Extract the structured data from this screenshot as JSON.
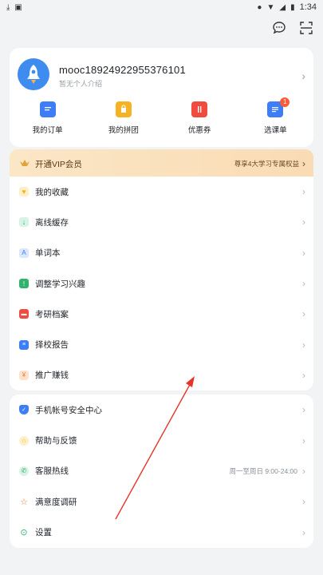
{
  "status_bar": {
    "time": "1:34"
  },
  "profile": {
    "username": "mooc18924922955376101",
    "intro": "暂无个人介绍"
  },
  "quick_actions": [
    {
      "label": "我的订单",
      "icon": "order-icon",
      "color": "#3d7df5"
    },
    {
      "label": "我的拼团",
      "icon": "group-buy-icon",
      "color": "#f5b323"
    },
    {
      "label": "优惠券",
      "icon": "coupon-icon",
      "color": "#f04b3e"
    },
    {
      "label": "选课单",
      "icon": "course-list-icon",
      "color": "#3d7df5",
      "badge": "1"
    }
  ],
  "vip": {
    "label": "开通VIP会员",
    "benefit": "尊享4大学习专属权益"
  },
  "menu_group_1": [
    {
      "label": "我的收藏",
      "icon": "favorite-icon",
      "color": "#f5b323"
    },
    {
      "label": "离线缓存",
      "icon": "download-icon",
      "color": "#2fb36d"
    },
    {
      "label": "单词本",
      "icon": "vocabulary-icon",
      "color": "#3d7df5"
    },
    {
      "label": "调整学习兴趣",
      "icon": "interest-icon",
      "color": "#2fb36d"
    },
    {
      "label": "考研档案",
      "icon": "folder-icon",
      "color": "#f04b3e"
    },
    {
      "label": "择校报告",
      "icon": "report-icon",
      "color": "#3d7df5"
    },
    {
      "label": "推广赚钱",
      "icon": "money-bag-icon",
      "color": "#f07b2e"
    }
  ],
  "menu_group_2": [
    {
      "label": "手机帐号安全中心",
      "icon": "shield-icon",
      "color": "#3d7df5"
    },
    {
      "label": "帮助与反馈",
      "icon": "headset-icon",
      "color": "#f5b323"
    },
    {
      "label": "客服热线",
      "icon": "phone-icon",
      "color": "#2fb36d",
      "extra": "周一至周日 9:00-24:00"
    },
    {
      "label": "满意度调研",
      "icon": "star-icon",
      "color": "#f07b2e"
    },
    {
      "label": "设置",
      "icon": "settings-icon",
      "color": "#2fb36d"
    }
  ]
}
